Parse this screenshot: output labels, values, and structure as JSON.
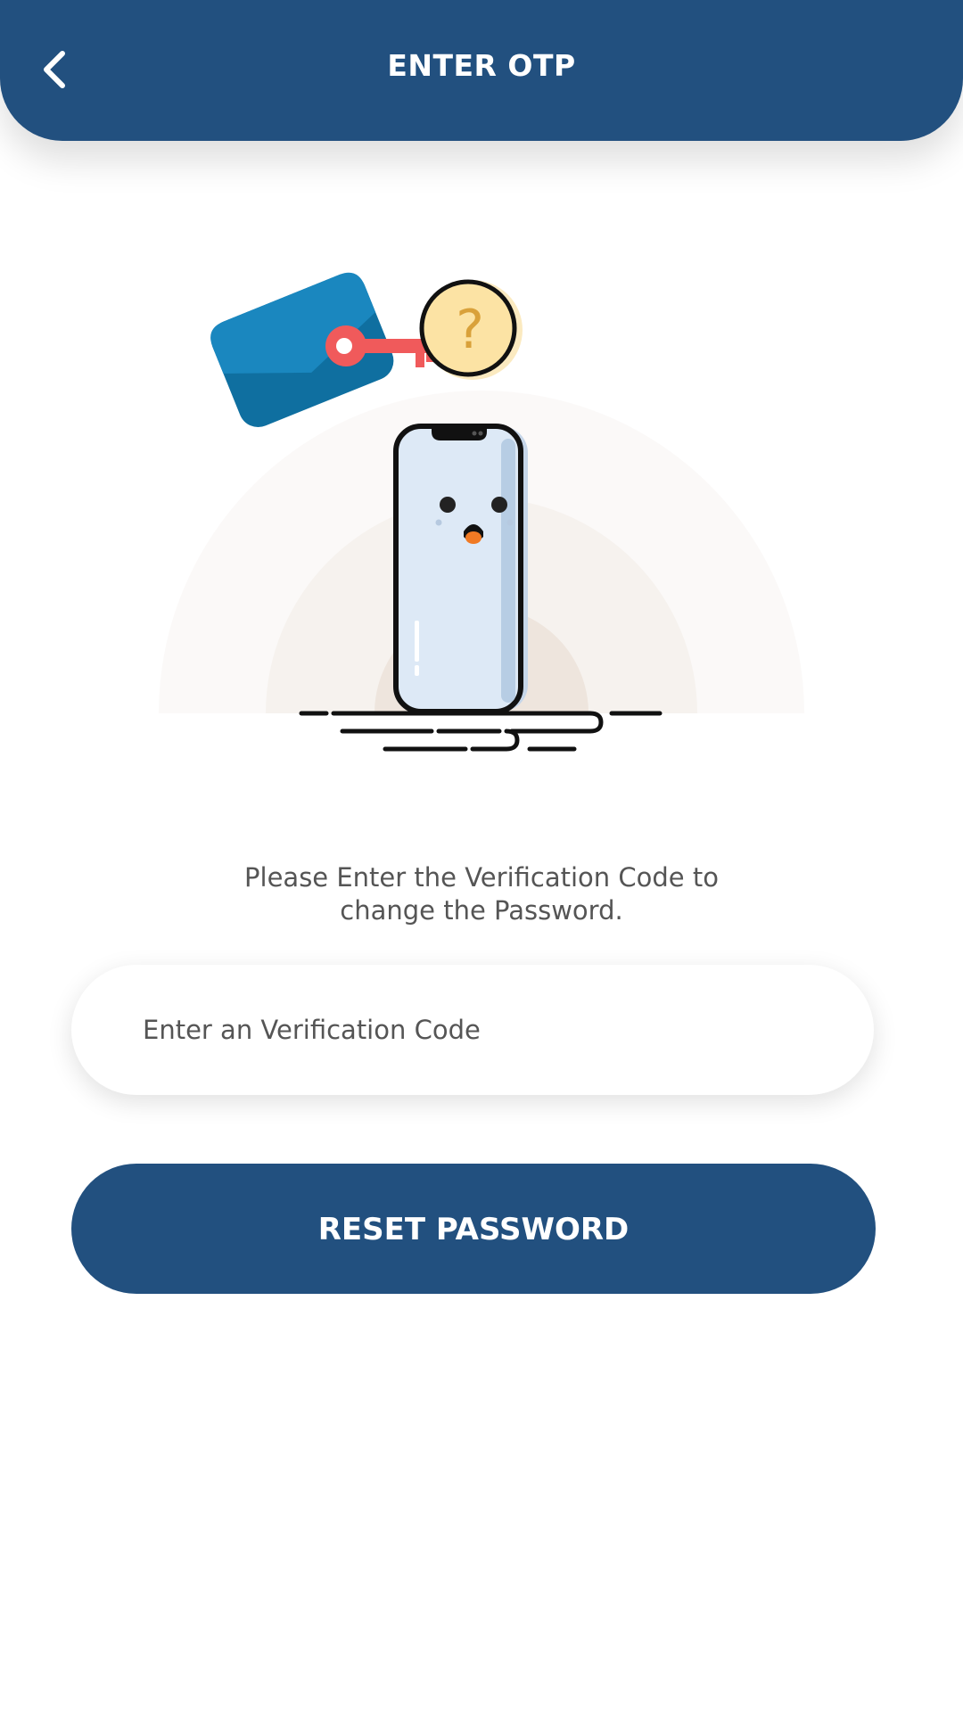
{
  "header": {
    "title": "ENTER OTP",
    "back_icon": "chevron-left-icon",
    "background_color": "#22507f"
  },
  "illustration": {
    "name": "surprised-phone-with-key-envelope",
    "question_mark": "?",
    "colors": {
      "envelope": "#1a7fb3",
      "key": "#f05a5b",
      "coin": "#fce3a4",
      "phone_screen": "#dde9f6",
      "mouth": "#f07a24"
    }
  },
  "instructions": {
    "line1": "Please Enter the Verification Code to",
    "line2": "change the Password."
  },
  "code_input": {
    "placeholder": "Enter an Verification Code",
    "value": ""
  },
  "reset_button": {
    "label": "RESET PASSWORD",
    "color": "#22507f"
  }
}
